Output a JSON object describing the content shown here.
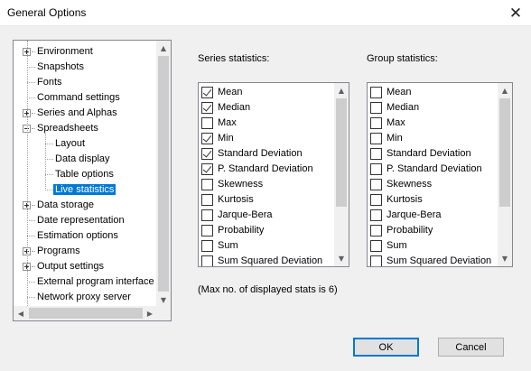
{
  "window": {
    "title": "General Options",
    "close_glyph": "✕"
  },
  "tree": {
    "items": [
      {
        "label": "Environment",
        "level": 0,
        "expander": "plus"
      },
      {
        "label": "Snapshots",
        "level": 0,
        "expander": "none"
      },
      {
        "label": "Fonts",
        "level": 0,
        "expander": "none"
      },
      {
        "label": "Command settings",
        "level": 0,
        "expander": "none"
      },
      {
        "label": "Series and Alphas",
        "level": 0,
        "expander": "plus"
      },
      {
        "label": "Spreadsheets",
        "level": 0,
        "expander": "minus"
      },
      {
        "label": "Layout",
        "level": 1,
        "expander": "none"
      },
      {
        "label": "Data display",
        "level": 1,
        "expander": "none"
      },
      {
        "label": "Table options",
        "level": 1,
        "expander": "none"
      },
      {
        "label": "Live statistics",
        "level": 1,
        "expander": "none",
        "selected": true
      },
      {
        "label": "Data storage",
        "level": 0,
        "expander": "plus"
      },
      {
        "label": "Date representation",
        "level": 0,
        "expander": "none"
      },
      {
        "label": "Estimation options",
        "level": 0,
        "expander": "none"
      },
      {
        "label": "Programs",
        "level": 0,
        "expander": "plus"
      },
      {
        "label": "Output settings",
        "level": 0,
        "expander": "plus"
      },
      {
        "label": "External program interface",
        "level": 0,
        "expander": "none"
      },
      {
        "label": "Network proxy server",
        "level": 0,
        "expander": "none"
      }
    ]
  },
  "series_stats": {
    "label": "Series statistics:",
    "items": [
      {
        "label": "Mean",
        "checked": true
      },
      {
        "label": "Median",
        "checked": true
      },
      {
        "label": "Max",
        "checked": false
      },
      {
        "label": "Min",
        "checked": true
      },
      {
        "label": "Standard Deviation",
        "checked": true
      },
      {
        "label": "P. Standard Deviation",
        "checked": true
      },
      {
        "label": "Skewness",
        "checked": false
      },
      {
        "label": "Kurtosis",
        "checked": false
      },
      {
        "label": "Jarque-Bera",
        "checked": false
      },
      {
        "label": "Probability",
        "checked": false
      },
      {
        "label": "Sum",
        "checked": false
      },
      {
        "label": "Sum Squared Deviation",
        "checked": false
      }
    ]
  },
  "group_stats": {
    "label": "Group statistics:",
    "items": [
      {
        "label": "Mean",
        "checked": false
      },
      {
        "label": "Median",
        "checked": false
      },
      {
        "label": "Max",
        "checked": false
      },
      {
        "label": "Min",
        "checked": false
      },
      {
        "label": "Standard Deviation",
        "checked": false
      },
      {
        "label": "P. Standard Deviation",
        "checked": false
      },
      {
        "label": "Skewness",
        "checked": false
      },
      {
        "label": "Kurtosis",
        "checked": false
      },
      {
        "label": "Jarque-Bera",
        "checked": false
      },
      {
        "label": "Probability",
        "checked": false
      },
      {
        "label": "Sum",
        "checked": false
      },
      {
        "label": "Sum Squared Deviation",
        "checked": false
      }
    ]
  },
  "note": "(Max no. of displayed stats is 6)",
  "buttons": {
    "ok": "OK",
    "cancel": "Cancel"
  },
  "colors": {
    "selection": "#0078d7",
    "default_button_border": "#0078d7"
  }
}
